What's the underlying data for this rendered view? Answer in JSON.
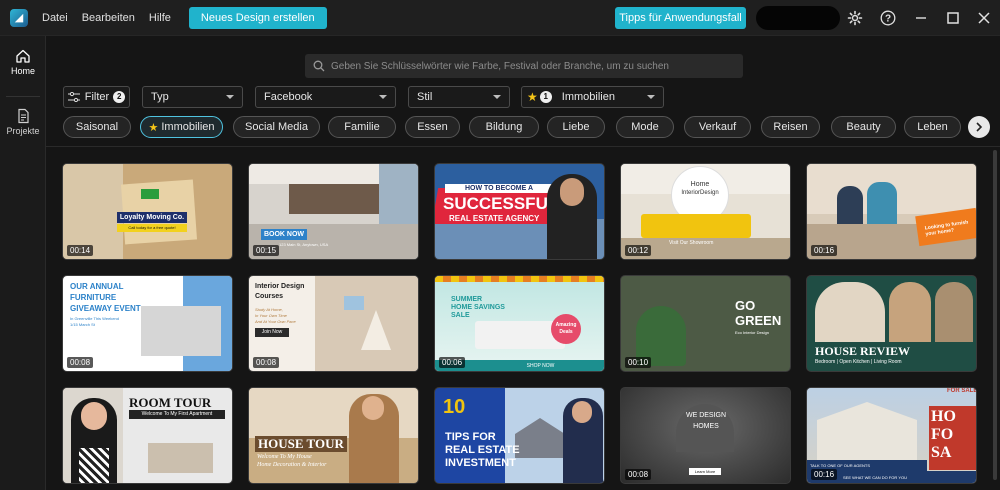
{
  "menu": {
    "file": "Datei",
    "edit": "Bearbeiten",
    "help": "Hilfe"
  },
  "buttons": {
    "new_design": "Neues Design erstellen",
    "tips": "Tipps für Anwendungsfall"
  },
  "sidebar": {
    "home": "Home",
    "projects": "Projekte"
  },
  "search": {
    "placeholder": "Geben Sie Schlüsselwörter wie Farbe, Festival oder Branche, um zu suchen"
  },
  "filters": {
    "filter_label": "Filter",
    "filter_count": "2",
    "type": "Typ",
    "platform": "Facebook",
    "style": "Stil",
    "industry_count": "1",
    "industry": "Immobilien"
  },
  "chips": [
    "Saisonal",
    "Immobilien",
    "Social Media",
    "Familie",
    "Essen",
    "Bildung",
    "Liebe",
    "Mode",
    "Verkauf",
    "Reisen",
    "Beauty",
    "Leben"
  ],
  "colors": {
    "accent": "#20b3cc",
    "background": "#151515",
    "titlebar": "#1f1f1f"
  },
  "cards": [
    {
      "duration": "00:14",
      "texts": {
        "title": "Loyalty Moving Co.",
        "sub": "Call today for a free quote!"
      }
    },
    {
      "duration": "00:15",
      "texts": {
        "title": "BOOK NOW",
        "sub": "123 Main St, Anytown, USA"
      }
    },
    {
      "duration": "",
      "texts": {
        "line1": "HOW TO BECOME A",
        "line2": "SUCCESSFUL",
        "line3": "REAL ESTATE AGENCY"
      }
    },
    {
      "duration": "00:12",
      "texts": {
        "line1": "Home",
        "line2": "InteriorDesign",
        "sub": "Visit Our Showroom"
      }
    },
    {
      "duration": "00:16",
      "texts": {
        "tag": "Looking to furnish your home?"
      }
    },
    {
      "duration": "00:08",
      "texts": {
        "line1": "OUR ANNUAL",
        "line2": "FURNITURE",
        "line3": "GIVEAWAY EVENT",
        "sub1": "In Greenville This Weekend",
        "sub2": "1/15 March St"
      }
    },
    {
      "duration": "00:08",
      "texts": {
        "line1": "Interior Design",
        "line2": "Courses",
        "sub1": "Study At Home,",
        "sub2": "In Your Own Time",
        "sub3": "And At Your Own Pace",
        "cta": "Join Now"
      }
    },
    {
      "duration": "00:06",
      "texts": {
        "line1": "SUMMER",
        "line2": "HOME SAVINGS",
        "line3": "SALE",
        "badge1": "Amazing",
        "badge2": "Deals",
        "cta": "SHOP NOW"
      }
    },
    {
      "duration": "00:10",
      "texts": {
        "line1": "GO",
        "line2": "GREEN",
        "sub": "Eco Interior Design"
      }
    },
    {
      "duration": "",
      "texts": {
        "title": "HOUSE REVIEW",
        "sub": "Bedroom | Open Kitchen | Living Room"
      }
    },
    {
      "duration": "",
      "texts": {
        "title": "ROOM TOUR",
        "sub": "Welcome To My First Apartment"
      }
    },
    {
      "duration": "",
      "texts": {
        "title": "HOUSE TOUR",
        "sub1": "Welcome To My House",
        "sub2": "Home Decoration & Interior"
      }
    },
    {
      "duration": "",
      "texts": {
        "num": "10",
        "line1": "TIPS FOR",
        "line2": "REAL ESTATE",
        "line3": "INVESTMENT"
      }
    },
    {
      "duration": "00:08",
      "texts": {
        "line1": "WE DESIGN",
        "line2": "HOMES",
        "cta": "Learn More"
      }
    },
    {
      "duration": "00:16",
      "texts": {
        "top": "FOR SALE",
        "sign1": "HO",
        "sign2": "FO",
        "sign3": "SA",
        "sub": "TALK TO ONE OF OUR AGENTS",
        "sub2": "SEE WHAT WE CAN DO FOR YOU"
      }
    }
  ]
}
